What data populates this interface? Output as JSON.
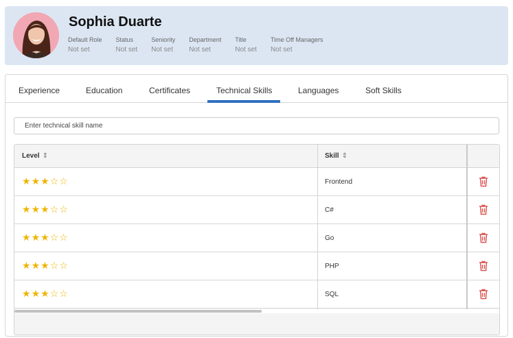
{
  "profile": {
    "name": "Sophia Duarte",
    "avatar_icon": "user-avatar-photo",
    "fields": [
      {
        "label": "Default Role",
        "value": "Not set"
      },
      {
        "label": "Status",
        "value": "Not set"
      },
      {
        "label": "Seniority",
        "value": "Not set"
      },
      {
        "label": "Department",
        "value": "Not set"
      },
      {
        "label": "Title",
        "value": "Not set"
      },
      {
        "label": "Time Off Managers",
        "value": "Not set"
      }
    ]
  },
  "tabs": [
    {
      "label": "Experience"
    },
    {
      "label": "Education"
    },
    {
      "label": "Certificates"
    },
    {
      "label": "Technical Skills",
      "active": true
    },
    {
      "label": "Languages"
    },
    {
      "label": "Soft Skills"
    }
  ],
  "search": {
    "placeholder": "Enter technical skill name"
  },
  "table": {
    "columns": [
      {
        "label": "Level",
        "sort_icon": "sort-icon"
      },
      {
        "label": "Skill",
        "sort_icon": "sort-icon"
      }
    ],
    "rows": [
      {
        "level": 3,
        "max_level": 5,
        "skill": "Frontend"
      },
      {
        "level": 3,
        "max_level": 5,
        "skill": "C#"
      },
      {
        "level": 3,
        "max_level": 5,
        "skill": "Go"
      },
      {
        "level": 3,
        "max_level": 5,
        "skill": "PHP"
      },
      {
        "level": 3,
        "max_level": 5,
        "skill": "SQL"
      }
    ],
    "delete_icon": "trash-icon",
    "horizontal_scroll_fraction": 0.51
  },
  "colors": {
    "header_bg": "#dce6f3",
    "tab_active": "#2f6fbf",
    "star": "#f0b400",
    "delete": "#d9534f"
  }
}
